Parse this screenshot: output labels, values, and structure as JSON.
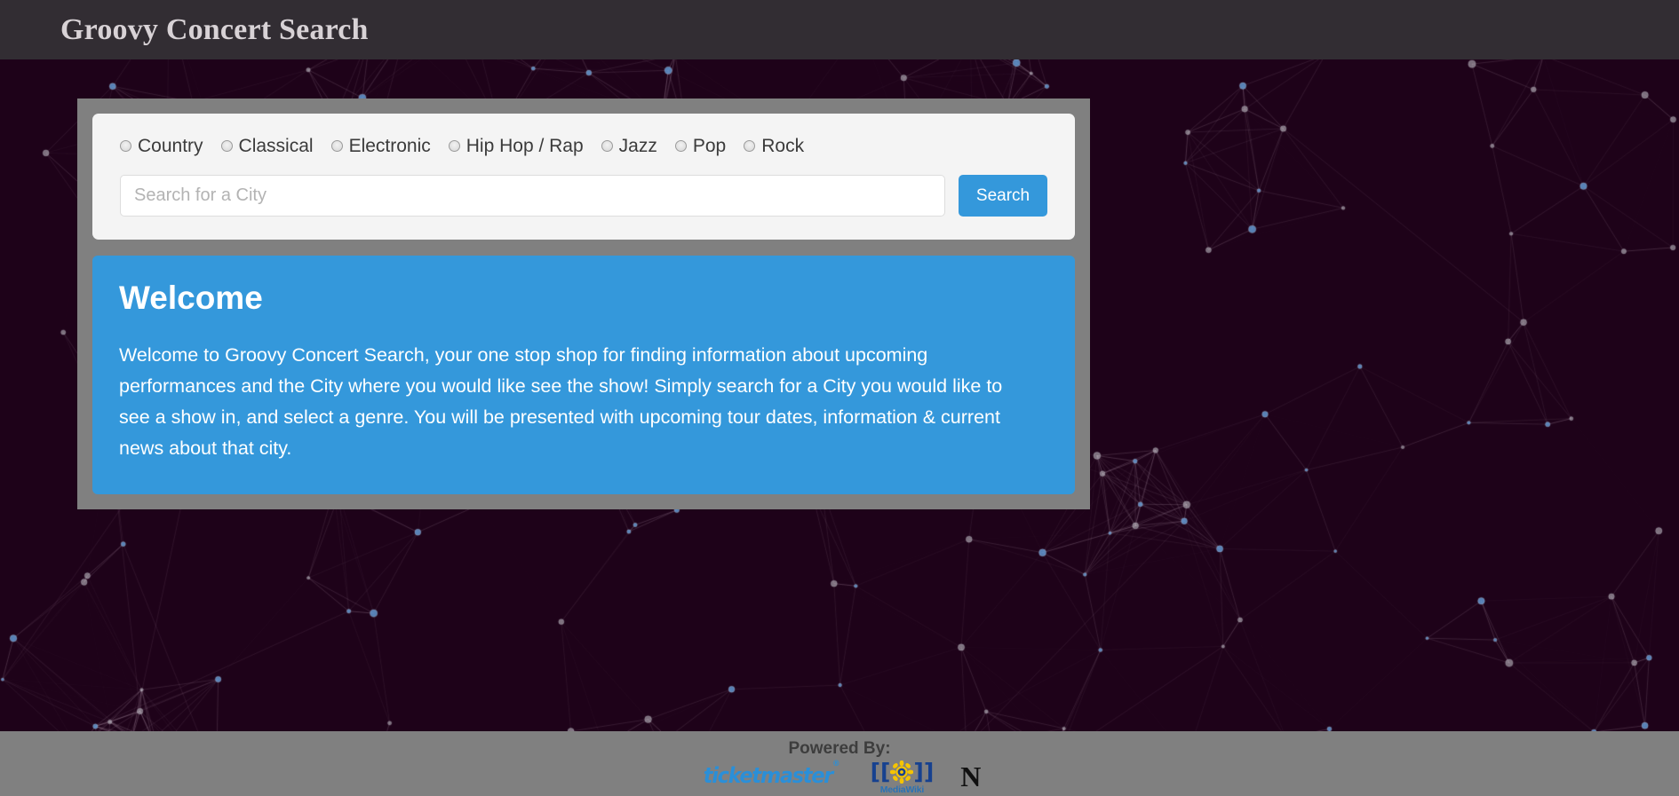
{
  "header": {
    "title": "Groovy Concert Search"
  },
  "search": {
    "genres": [
      {
        "label": "Country",
        "icon": "radio-unchecked-icon",
        "selected": false
      },
      {
        "label": "Classical",
        "icon": "radio-unchecked-icon",
        "selected": false
      },
      {
        "label": "Electronic",
        "icon": "radio-unchecked-icon",
        "selected": false
      },
      {
        "label": "Hip Hop / Rap",
        "icon": "radio-unchecked-icon",
        "selected": false
      },
      {
        "label": "Jazz",
        "icon": "radio-unchecked-icon",
        "selected": false
      },
      {
        "label": "Pop",
        "icon": "radio-unchecked-icon",
        "selected": false
      },
      {
        "label": "Rock",
        "icon": "radio-unchecked-icon",
        "selected": false
      }
    ],
    "city_placeholder": "Search for a City",
    "city_value": "",
    "search_button_label": "Search"
  },
  "welcome": {
    "heading": "Welcome",
    "body": "Welcome to Groovy Concert Search, your one stop shop for finding information about upcoming performances and the City where you would like see the show! Simply search for a City you would like to see a show in, and select a genre. You will be presented with upcoming tour dates, information & current news about that city."
  },
  "footer": {
    "powered_by_label": "Powered By:",
    "logos": [
      {
        "name": "ticketmaster-logo",
        "text": "ticketmaster",
        "mark": "®"
      },
      {
        "name": "mediawiki-logo",
        "text": "MediaWiki",
        "left_bracket": "[[",
        "right_bracket": "]]"
      },
      {
        "name": "nytimes-logo",
        "text": "N"
      }
    ]
  },
  "colors": {
    "page_background": "#1e0219",
    "header_bar": "#322d33",
    "container": "#808080",
    "card": "#f4f4f4",
    "accent_blue": "#3498db",
    "footer_bar": "#808080",
    "title_text": "#d8d2d6",
    "ticketmaster_blue": "#2a8fd8",
    "mediawiki_blue": "#17418f",
    "mediawiki_yellow": "#f5c400"
  }
}
